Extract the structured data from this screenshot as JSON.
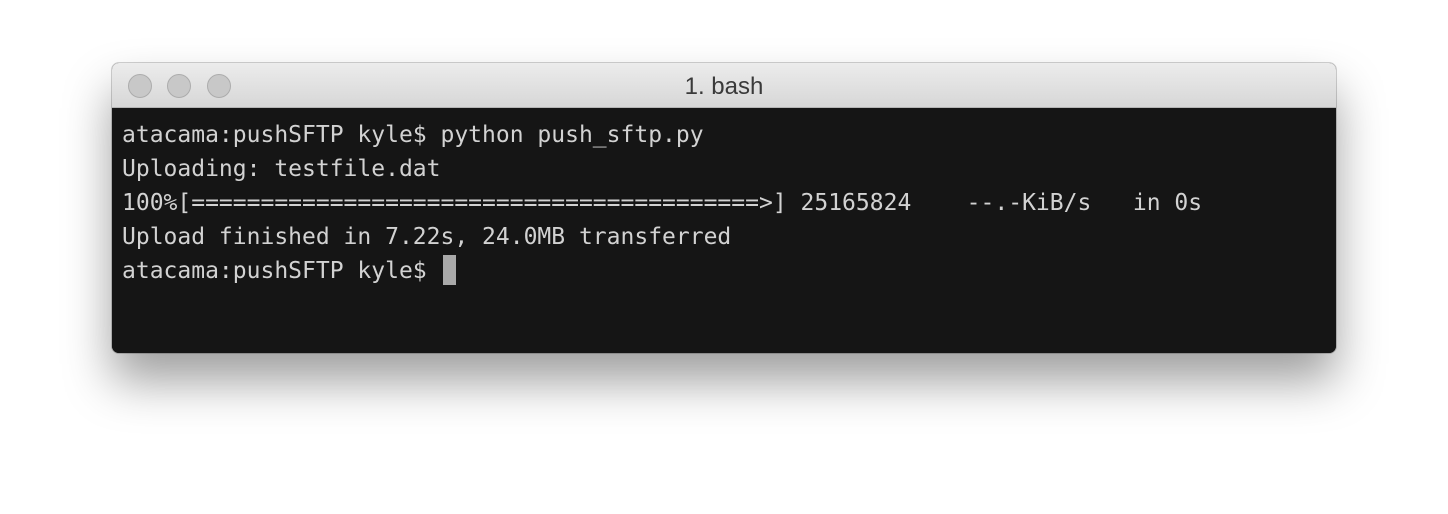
{
  "window": {
    "title": "1. bash"
  },
  "terminal": {
    "lines": [
      "atacama:pushSFTP kyle$ python push_sftp.py",
      "Uploading: testfile.dat",
      "100%[=========================================>] 25165824    --.-KiB/s   in 0s",
      "Upload finished in 7.22s, 24.0MB transferred"
    ],
    "prompt": "atacama:pushSFTP kyle$ "
  },
  "icons": {
    "close": "close-button-icon",
    "minimize": "minimize-button-icon",
    "zoom": "zoom-button-icon"
  }
}
